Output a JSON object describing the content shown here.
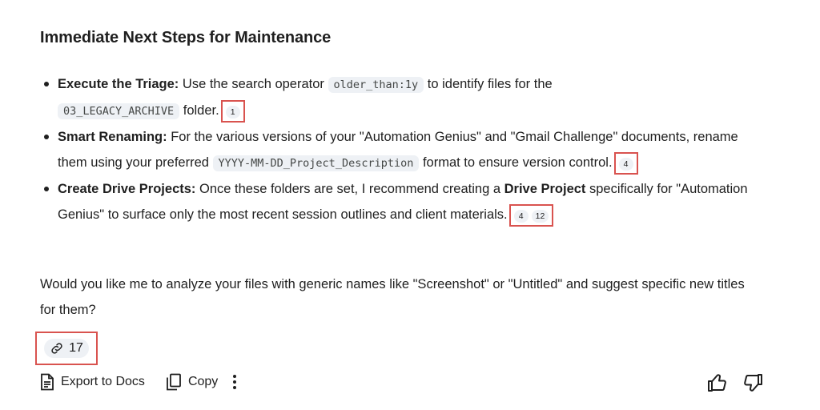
{
  "heading": "Immediate Next Steps for Maintenance",
  "bullets": [
    {
      "title": "Execute the Triage:",
      "text_before": " Use the search operator ",
      "code": "older_than:1y",
      "text_after": " to identify files for the",
      "code2": "03_LEGACY_ARCHIVE",
      "text_end": " folder.",
      "citations": [
        "1"
      ]
    },
    {
      "title": "Smart Renaming:",
      "text_before": " For the various versions of your \"Automation Genius\" and \"Gmail Challenge\" documents, rename them using your preferred ",
      "code": "YYYY-MM-DD_Project_Description",
      "text_after": " format to ensure version control.",
      "citations": [
        "4"
      ]
    },
    {
      "title": "Create Drive Projects:",
      "text_before": " Once these folders are set, I recommend creating a ",
      "bold_inline": "Drive Project",
      "text_after": " specifically for \"Automation Genius\" to surface only the most recent session outlines and client materials.",
      "citations": [
        "4",
        "12"
      ]
    }
  ],
  "question": "Would you like me to analyze your files with generic names like \"Screenshot\" or \"Untitled\" and suggest specific new titles for them?",
  "sources": {
    "icon": "link-icon",
    "count": "17"
  },
  "actions": {
    "export_label": "Export to Docs",
    "copy_label": "Copy",
    "more_icon": "more-vert-icon"
  },
  "feedback": {
    "up_icon": "thumb-up-icon",
    "down_icon": "thumb-down-icon"
  },
  "colors": {
    "highlight_border": "#d9534f",
    "chip_bg": "#eef1f5",
    "text": "#1f1f1f"
  }
}
